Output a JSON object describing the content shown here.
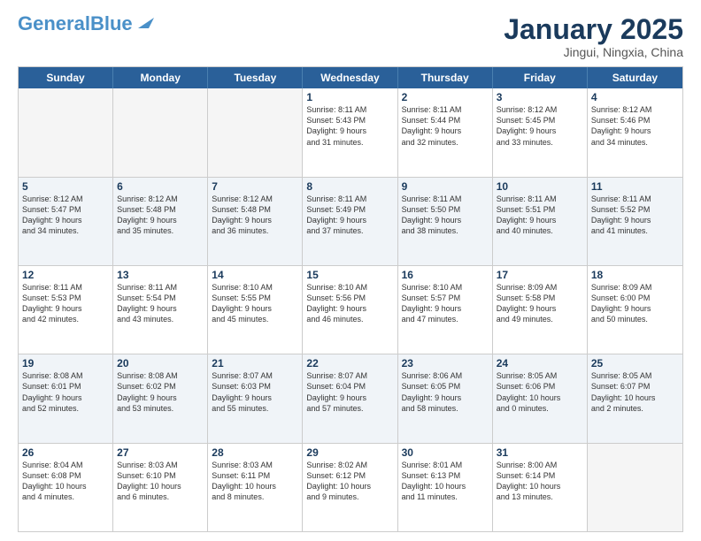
{
  "header": {
    "logo_line1": "General",
    "logo_line2": "Blue",
    "month": "January 2025",
    "location": "Jingui, Ningxia, China"
  },
  "weekdays": [
    "Sunday",
    "Monday",
    "Tuesday",
    "Wednesday",
    "Thursday",
    "Friday",
    "Saturday"
  ],
  "rows": [
    [
      {
        "day": "",
        "text": "",
        "empty": true
      },
      {
        "day": "",
        "text": "",
        "empty": true
      },
      {
        "day": "",
        "text": "",
        "empty": true
      },
      {
        "day": "1",
        "text": "Sunrise: 8:11 AM\nSunset: 5:43 PM\nDaylight: 9 hours\nand 31 minutes."
      },
      {
        "day": "2",
        "text": "Sunrise: 8:11 AM\nSunset: 5:44 PM\nDaylight: 9 hours\nand 32 minutes."
      },
      {
        "day": "3",
        "text": "Sunrise: 8:12 AM\nSunset: 5:45 PM\nDaylight: 9 hours\nand 33 minutes."
      },
      {
        "day": "4",
        "text": "Sunrise: 8:12 AM\nSunset: 5:46 PM\nDaylight: 9 hours\nand 34 minutes."
      }
    ],
    [
      {
        "day": "5",
        "text": "Sunrise: 8:12 AM\nSunset: 5:47 PM\nDaylight: 9 hours\nand 34 minutes."
      },
      {
        "day": "6",
        "text": "Sunrise: 8:12 AM\nSunset: 5:48 PM\nDaylight: 9 hours\nand 35 minutes."
      },
      {
        "day": "7",
        "text": "Sunrise: 8:12 AM\nSunset: 5:48 PM\nDaylight: 9 hours\nand 36 minutes."
      },
      {
        "day": "8",
        "text": "Sunrise: 8:11 AM\nSunset: 5:49 PM\nDaylight: 9 hours\nand 37 minutes."
      },
      {
        "day": "9",
        "text": "Sunrise: 8:11 AM\nSunset: 5:50 PM\nDaylight: 9 hours\nand 38 minutes."
      },
      {
        "day": "10",
        "text": "Sunrise: 8:11 AM\nSunset: 5:51 PM\nDaylight: 9 hours\nand 40 minutes."
      },
      {
        "day": "11",
        "text": "Sunrise: 8:11 AM\nSunset: 5:52 PM\nDaylight: 9 hours\nand 41 minutes."
      }
    ],
    [
      {
        "day": "12",
        "text": "Sunrise: 8:11 AM\nSunset: 5:53 PM\nDaylight: 9 hours\nand 42 minutes."
      },
      {
        "day": "13",
        "text": "Sunrise: 8:11 AM\nSunset: 5:54 PM\nDaylight: 9 hours\nand 43 minutes."
      },
      {
        "day": "14",
        "text": "Sunrise: 8:10 AM\nSunset: 5:55 PM\nDaylight: 9 hours\nand 45 minutes."
      },
      {
        "day": "15",
        "text": "Sunrise: 8:10 AM\nSunset: 5:56 PM\nDaylight: 9 hours\nand 46 minutes."
      },
      {
        "day": "16",
        "text": "Sunrise: 8:10 AM\nSunset: 5:57 PM\nDaylight: 9 hours\nand 47 minutes."
      },
      {
        "day": "17",
        "text": "Sunrise: 8:09 AM\nSunset: 5:58 PM\nDaylight: 9 hours\nand 49 minutes."
      },
      {
        "day": "18",
        "text": "Sunrise: 8:09 AM\nSunset: 6:00 PM\nDaylight: 9 hours\nand 50 minutes."
      }
    ],
    [
      {
        "day": "19",
        "text": "Sunrise: 8:08 AM\nSunset: 6:01 PM\nDaylight: 9 hours\nand 52 minutes."
      },
      {
        "day": "20",
        "text": "Sunrise: 8:08 AM\nSunset: 6:02 PM\nDaylight: 9 hours\nand 53 minutes."
      },
      {
        "day": "21",
        "text": "Sunrise: 8:07 AM\nSunset: 6:03 PM\nDaylight: 9 hours\nand 55 minutes."
      },
      {
        "day": "22",
        "text": "Sunrise: 8:07 AM\nSunset: 6:04 PM\nDaylight: 9 hours\nand 57 minutes."
      },
      {
        "day": "23",
        "text": "Sunrise: 8:06 AM\nSunset: 6:05 PM\nDaylight: 9 hours\nand 58 minutes."
      },
      {
        "day": "24",
        "text": "Sunrise: 8:05 AM\nSunset: 6:06 PM\nDaylight: 10 hours\nand 0 minutes."
      },
      {
        "day": "25",
        "text": "Sunrise: 8:05 AM\nSunset: 6:07 PM\nDaylight: 10 hours\nand 2 minutes."
      }
    ],
    [
      {
        "day": "26",
        "text": "Sunrise: 8:04 AM\nSunset: 6:08 PM\nDaylight: 10 hours\nand 4 minutes."
      },
      {
        "day": "27",
        "text": "Sunrise: 8:03 AM\nSunset: 6:10 PM\nDaylight: 10 hours\nand 6 minutes."
      },
      {
        "day": "28",
        "text": "Sunrise: 8:03 AM\nSunset: 6:11 PM\nDaylight: 10 hours\nand 8 minutes."
      },
      {
        "day": "29",
        "text": "Sunrise: 8:02 AM\nSunset: 6:12 PM\nDaylight: 10 hours\nand 9 minutes."
      },
      {
        "day": "30",
        "text": "Sunrise: 8:01 AM\nSunset: 6:13 PM\nDaylight: 10 hours\nand 11 minutes."
      },
      {
        "day": "31",
        "text": "Sunrise: 8:00 AM\nSunset: 6:14 PM\nDaylight: 10 hours\nand 13 minutes."
      },
      {
        "day": "",
        "text": "",
        "empty": true
      }
    ]
  ]
}
